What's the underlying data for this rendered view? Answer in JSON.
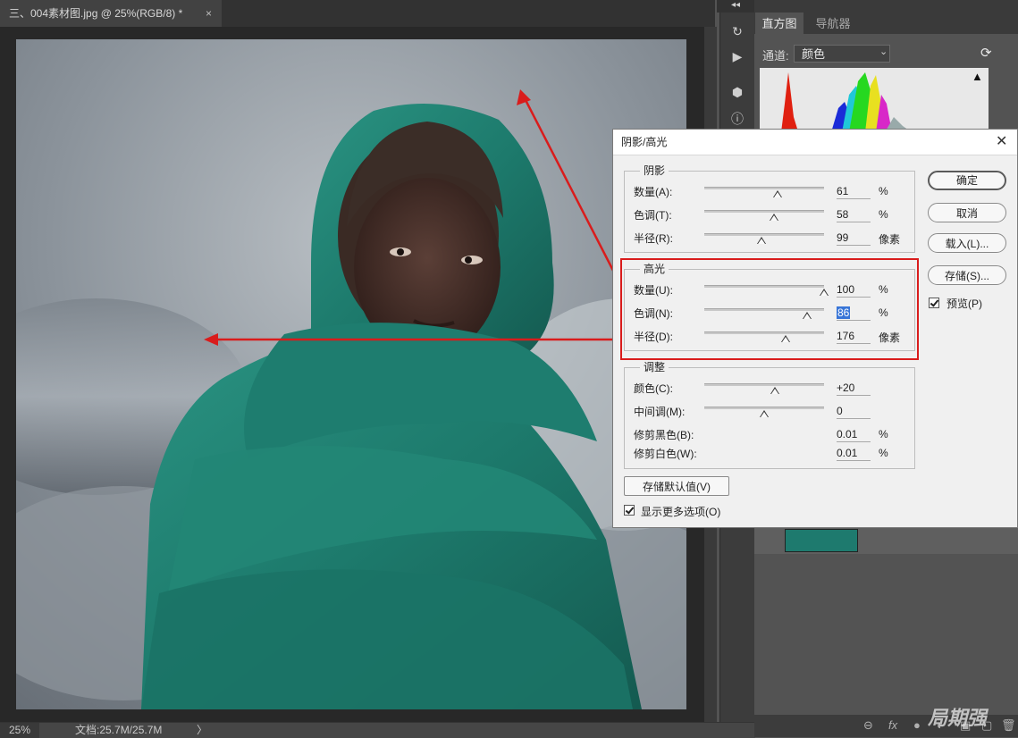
{
  "document": {
    "tab_title": "三、004素材图.jpg @ 25%(RGB/8) *",
    "close_glyph": "×"
  },
  "status": {
    "zoom": "25%",
    "doc_info": "文档:25.7M/25.7M",
    "arrow": "〉"
  },
  "panel": {
    "collapse_glyph": "◂◂",
    "tabs": [
      "直方图",
      "导航器"
    ],
    "channel_label": "通道:",
    "channel_value": "颜色",
    "layer_icons": [
      "⊖",
      "fx",
      "●",
      "◐",
      "▣",
      "▢",
      "🗑"
    ]
  },
  "watermark": "局期强",
  "dialog": {
    "title": "阴影/高光",
    "shadows": {
      "label": "阴影",
      "rows": [
        {
          "label": "数量(A):",
          "value": "61",
          "unit": "%",
          "level": 0.61
        },
        {
          "label": "色调(T):",
          "value": "58",
          "unit": "%",
          "level": 0.58
        },
        {
          "label": "半径(R):",
          "value": "99",
          "unit": "像素",
          "level": 0.48
        }
      ]
    },
    "highlights": {
      "label": "高光",
      "rows": [
        {
          "label": "数量(U):",
          "value": "100",
          "unit": "%",
          "level": 1.0
        },
        {
          "label": "色调(N):",
          "value": "86",
          "unit": "%",
          "level": 0.86
        },
        {
          "label": "半径(D):",
          "value": "176",
          "unit": "像素",
          "level": 0.68
        }
      ]
    },
    "adjust": {
      "label": "调整",
      "rows": [
        {
          "label": "颜色(C):",
          "value": "+20",
          "unit": "",
          "level": 0.59
        },
        {
          "label": "中间调(M):",
          "value": "0",
          "unit": "",
          "level": 0.5
        },
        {
          "label": "修剪黑色(B):",
          "value": "0.01",
          "unit": "%"
        },
        {
          "label": "修剪白色(W):",
          "value": "0.01",
          "unit": "%"
        }
      ]
    },
    "buttons": {
      "ok": "确定",
      "cancel": "取消",
      "load": "载入(L)...",
      "save": "存储(S)...",
      "preview": "预览(P)",
      "save_defaults": "存储默认值(V)",
      "more_options": "显示更多选项(O)"
    }
  },
  "colors": {
    "scarf": "#1f8274",
    "annotation": "#d91c1c",
    "selection": "#3875d7"
  }
}
